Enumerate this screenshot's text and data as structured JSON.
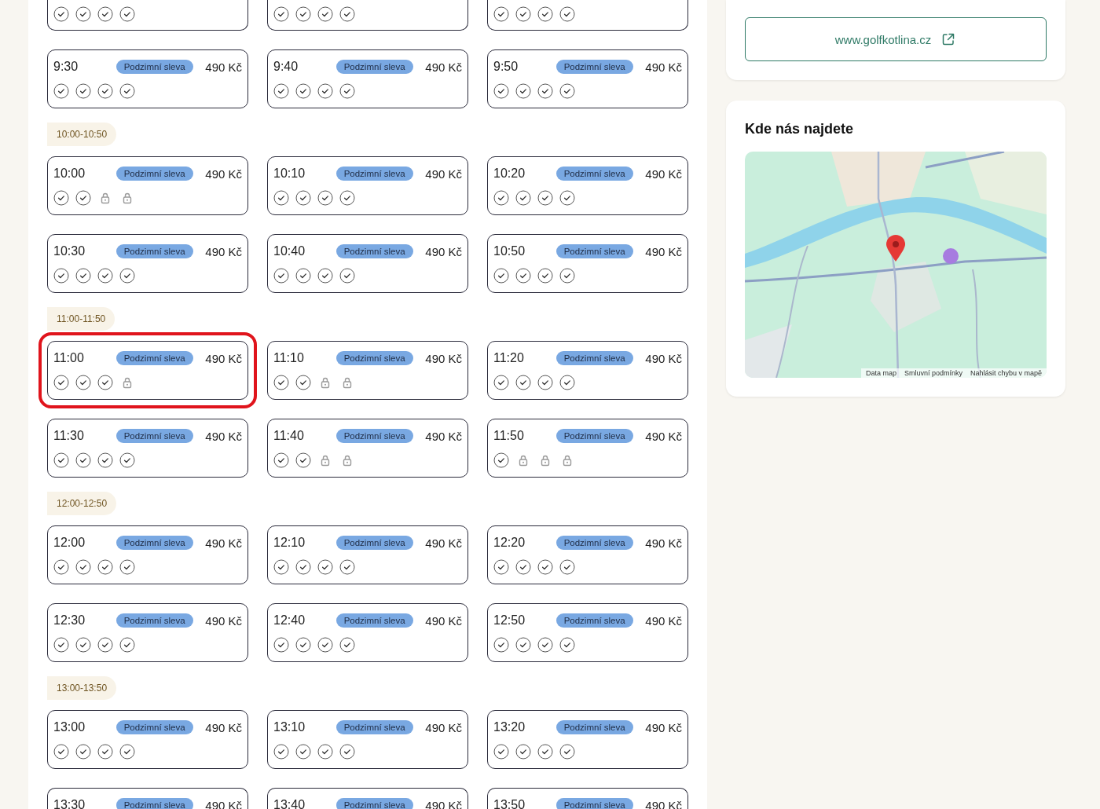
{
  "slot_groups": [
    {
      "cards": [
        {
          "kind": "top-cut",
          "highlighted": false,
          "slots": [
            {
              "locked": false
            },
            {
              "locked": false
            },
            {
              "locked": false
            },
            {
              "locked": false
            }
          ]
        },
        {
          "kind": "top-cut",
          "highlighted": false,
          "slots": [
            {
              "locked": false
            },
            {
              "locked": false
            },
            {
              "locked": false
            },
            {
              "locked": false
            }
          ]
        },
        {
          "kind": "top-cut",
          "highlighted": false,
          "slots": [
            {
              "locked": false
            },
            {
              "locked": false
            },
            {
              "locked": false
            },
            {
              "locked": false
            }
          ]
        },
        {
          "kind": "full",
          "time": "9:30",
          "badge": "Podzimní sleva",
          "price": "490 Kč",
          "highlighted": false,
          "slots": [
            {
              "locked": false
            },
            {
              "locked": false
            },
            {
              "locked": false
            },
            {
              "locked": false
            }
          ]
        },
        {
          "kind": "full",
          "time": "9:40",
          "badge": "Podzimní sleva",
          "price": "490 Kč",
          "highlighted": false,
          "slots": [
            {
              "locked": false
            },
            {
              "locked": false
            },
            {
              "locked": false
            },
            {
              "locked": false
            }
          ]
        },
        {
          "kind": "full",
          "time": "9:50",
          "badge": "Podzimní sleva",
          "price": "490 Kč",
          "highlighted": false,
          "slots": [
            {
              "locked": false
            },
            {
              "locked": false
            },
            {
              "locked": false
            },
            {
              "locked": false
            }
          ]
        }
      ]
    },
    {
      "label": "10:00-10:50",
      "cards": [
        {
          "kind": "full",
          "time": "10:00",
          "badge": "Podzimní sleva",
          "price": "490 Kč",
          "highlighted": false,
          "slots": [
            {
              "locked": false
            },
            {
              "locked": false
            },
            {
              "locked": true
            },
            {
              "locked": true
            }
          ]
        },
        {
          "kind": "full",
          "time": "10:10",
          "badge": "Podzimní sleva",
          "price": "490 Kč",
          "highlighted": false,
          "slots": [
            {
              "locked": false
            },
            {
              "locked": false
            },
            {
              "locked": false
            },
            {
              "locked": false
            }
          ]
        },
        {
          "kind": "full",
          "time": "10:20",
          "badge": "Podzimní sleva",
          "price": "490 Kč",
          "highlighted": false,
          "slots": [
            {
              "locked": false
            },
            {
              "locked": false
            },
            {
              "locked": false
            },
            {
              "locked": false
            }
          ]
        },
        {
          "kind": "full",
          "time": "10:30",
          "badge": "Podzimní sleva",
          "price": "490 Kč",
          "highlighted": false,
          "slots": [
            {
              "locked": false
            },
            {
              "locked": false
            },
            {
              "locked": false
            },
            {
              "locked": false
            }
          ]
        },
        {
          "kind": "full",
          "time": "10:40",
          "badge": "Podzimní sleva",
          "price": "490 Kč",
          "highlighted": false,
          "slots": [
            {
              "locked": false
            },
            {
              "locked": false
            },
            {
              "locked": false
            },
            {
              "locked": false
            }
          ]
        },
        {
          "kind": "full",
          "time": "10:50",
          "badge": "Podzimní sleva",
          "price": "490 Kč",
          "highlighted": false,
          "slots": [
            {
              "locked": false
            },
            {
              "locked": false
            },
            {
              "locked": false
            },
            {
              "locked": false
            }
          ]
        }
      ]
    },
    {
      "label": "11:00-11:50",
      "cards": [
        {
          "kind": "full",
          "time": "11:00",
          "badge": "Podzimní sleva",
          "price": "490 Kč",
          "highlighted": true,
          "slots": [
            {
              "locked": false
            },
            {
              "locked": false
            },
            {
              "locked": false
            },
            {
              "locked": true
            }
          ]
        },
        {
          "kind": "full",
          "time": "11:10",
          "badge": "Podzimní sleva",
          "price": "490 Kč",
          "highlighted": false,
          "slots": [
            {
              "locked": false
            },
            {
              "locked": false
            },
            {
              "locked": true
            },
            {
              "locked": true
            }
          ]
        },
        {
          "kind": "full",
          "time": "11:20",
          "badge": "Podzimní sleva",
          "price": "490 Kč",
          "highlighted": false,
          "slots": [
            {
              "locked": false
            },
            {
              "locked": false
            },
            {
              "locked": false
            },
            {
              "locked": false
            }
          ]
        },
        {
          "kind": "full",
          "time": "11:30",
          "badge": "Podzimní sleva",
          "price": "490 Kč",
          "highlighted": false,
          "slots": [
            {
              "locked": false
            },
            {
              "locked": false
            },
            {
              "locked": false
            },
            {
              "locked": false
            }
          ]
        },
        {
          "kind": "full",
          "time": "11:40",
          "badge": "Podzimní sleva",
          "price": "490 Kč",
          "highlighted": false,
          "slots": [
            {
              "locked": false
            },
            {
              "locked": false
            },
            {
              "locked": true
            },
            {
              "locked": true
            }
          ]
        },
        {
          "kind": "full",
          "time": "11:50",
          "badge": "Podzimní sleva",
          "price": "490 Kč",
          "highlighted": false,
          "slots": [
            {
              "locked": false
            },
            {
              "locked": true
            },
            {
              "locked": true
            },
            {
              "locked": true
            }
          ]
        }
      ]
    },
    {
      "label": "12:00-12:50",
      "cards": [
        {
          "kind": "full",
          "time": "12:00",
          "badge": "Podzimní sleva",
          "price": "490 Kč",
          "highlighted": false,
          "slots": [
            {
              "locked": false
            },
            {
              "locked": false
            },
            {
              "locked": false
            },
            {
              "locked": false
            }
          ]
        },
        {
          "kind": "full",
          "time": "12:10",
          "badge": "Podzimní sleva",
          "price": "490 Kč",
          "highlighted": false,
          "slots": [
            {
              "locked": false
            },
            {
              "locked": false
            },
            {
              "locked": false
            },
            {
              "locked": false
            }
          ]
        },
        {
          "kind": "full",
          "time": "12:20",
          "badge": "Podzimní sleva",
          "price": "490 Kč",
          "highlighted": false,
          "slots": [
            {
              "locked": false
            },
            {
              "locked": false
            },
            {
              "locked": false
            },
            {
              "locked": false
            }
          ]
        },
        {
          "kind": "full",
          "time": "12:30",
          "badge": "Podzimní sleva",
          "price": "490 Kč",
          "highlighted": false,
          "slots": [
            {
              "locked": false
            },
            {
              "locked": false
            },
            {
              "locked": false
            },
            {
              "locked": false
            }
          ]
        },
        {
          "kind": "full",
          "time": "12:40",
          "badge": "Podzimní sleva",
          "price": "490 Kč",
          "highlighted": false,
          "slots": [
            {
              "locked": false
            },
            {
              "locked": false
            },
            {
              "locked": false
            },
            {
              "locked": false
            }
          ]
        },
        {
          "kind": "full",
          "time": "12:50",
          "badge": "Podzimní sleva",
          "price": "490 Kč",
          "highlighted": false,
          "slots": [
            {
              "locked": false
            },
            {
              "locked": false
            },
            {
              "locked": false
            },
            {
              "locked": false
            }
          ]
        }
      ]
    },
    {
      "label": "13:00-13:50",
      "cards": [
        {
          "kind": "full",
          "time": "13:00",
          "badge": "Podzimní sleva",
          "price": "490 Kč",
          "highlighted": false,
          "slots": [
            {
              "locked": false
            },
            {
              "locked": false
            },
            {
              "locked": false
            },
            {
              "locked": false
            }
          ]
        },
        {
          "kind": "full",
          "time": "13:10",
          "badge": "Podzimní sleva",
          "price": "490 Kč",
          "highlighted": false,
          "slots": [
            {
              "locked": false
            },
            {
              "locked": false
            },
            {
              "locked": false
            },
            {
              "locked": false
            }
          ]
        },
        {
          "kind": "full",
          "time": "13:20",
          "badge": "Podzimní sleva",
          "price": "490 Kč",
          "highlighted": false,
          "slots": [
            {
              "locked": false
            },
            {
              "locked": false
            },
            {
              "locked": false
            },
            {
              "locked": false
            }
          ]
        },
        {
          "kind": "bottom-cut",
          "time": "13:30",
          "badge": "Podzimní sleva",
          "price": "490 Kč",
          "highlighted": false
        },
        {
          "kind": "bottom-cut",
          "time": "13:40",
          "badge": "Podzimní sleva",
          "price": "490 Kč",
          "highlighted": false
        },
        {
          "kind": "bottom-cut",
          "time": "13:50",
          "badge": "Podzimní sleva",
          "price": "490 Kč",
          "highlighted": false
        }
      ]
    }
  ],
  "website_link": {
    "label": "www.golfkotlina.cz"
  },
  "location": {
    "title": "Kde nás najdete",
    "map": {
      "kind": "picture",
      "footer_links": [
        "Data map",
        "Smluvní podmínky",
        "Nahlásit chybu v mapě"
      ]
    }
  }
}
